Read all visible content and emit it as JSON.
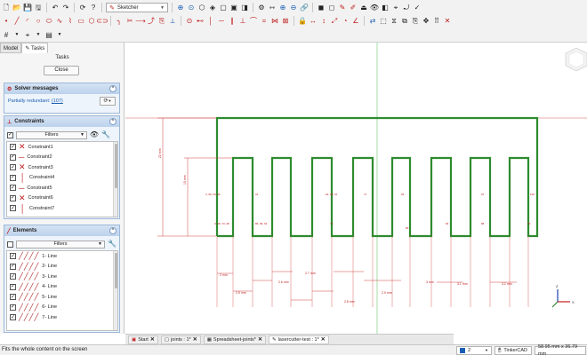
{
  "toolbar": {
    "workbench": "Sketcher"
  },
  "panel": {
    "tabs": [
      "Model",
      "Tasks"
    ],
    "title": "Tasks",
    "close_label": "Close",
    "solver": {
      "title": "Solver messages",
      "message": "Partially redundant:",
      "link": "(107)"
    },
    "constraints": {
      "title": "Constraints",
      "filter_label": "Filters",
      "items": [
        "Constraint1",
        "Constraint2",
        "Constraint3",
        "Constraint4",
        "Constraint5",
        "Constraint6",
        "Constraint7"
      ]
    },
    "elements": {
      "title": "Elements",
      "filter_label": "Filters",
      "items": [
        "1- Line",
        "2- Line",
        "3- Line",
        "4- Line",
        "5- Line",
        "6- Line",
        "7- Line"
      ]
    }
  },
  "view": {
    "dimensions": {
      "overall_height": "22 mm",
      "finger_height": "15 mm",
      "bottom": [
        "2 mm",
        "2.5 mm",
        "2.6 mm",
        "2.7 mm",
        "2.8 mm",
        "2.9 mm",
        "3 mm",
        "3.1 mm",
        "3.2 mm"
      ]
    },
    "constraint_labels": {
      "row1": [
        "4, 96, 63, 96",
        "31",
        "62, 98, 61",
        "71",
        "99",
        "97",
        "100"
      ],
      "row2": [
        "3, 68, 73, 08",
        "86, 68, 63",
        "73",
        "86",
        "84",
        "88",
        "90"
      ]
    },
    "axes": [
      "X",
      "Y",
      "Z"
    ]
  },
  "doc_tabs": [
    {
      "label": "Start",
      "active": false
    },
    {
      "label": "joints : 1*",
      "active": false
    },
    {
      "label": "Spreadsheet-joints*",
      "active": false
    },
    {
      "label": "lasercutter-test : 1*",
      "active": true
    }
  ],
  "status": {
    "message": "Fits the whole content on the screen",
    "page_value": "2",
    "navigation_style": "TinkerCAD",
    "dimensions": "58.95 mm x 36.79 mm"
  },
  "colors": {
    "sketch_line": "#2e8b2e",
    "dimension": "#c02020",
    "axis_v": "#7fcf7f",
    "axis_h": "#d98080"
  }
}
